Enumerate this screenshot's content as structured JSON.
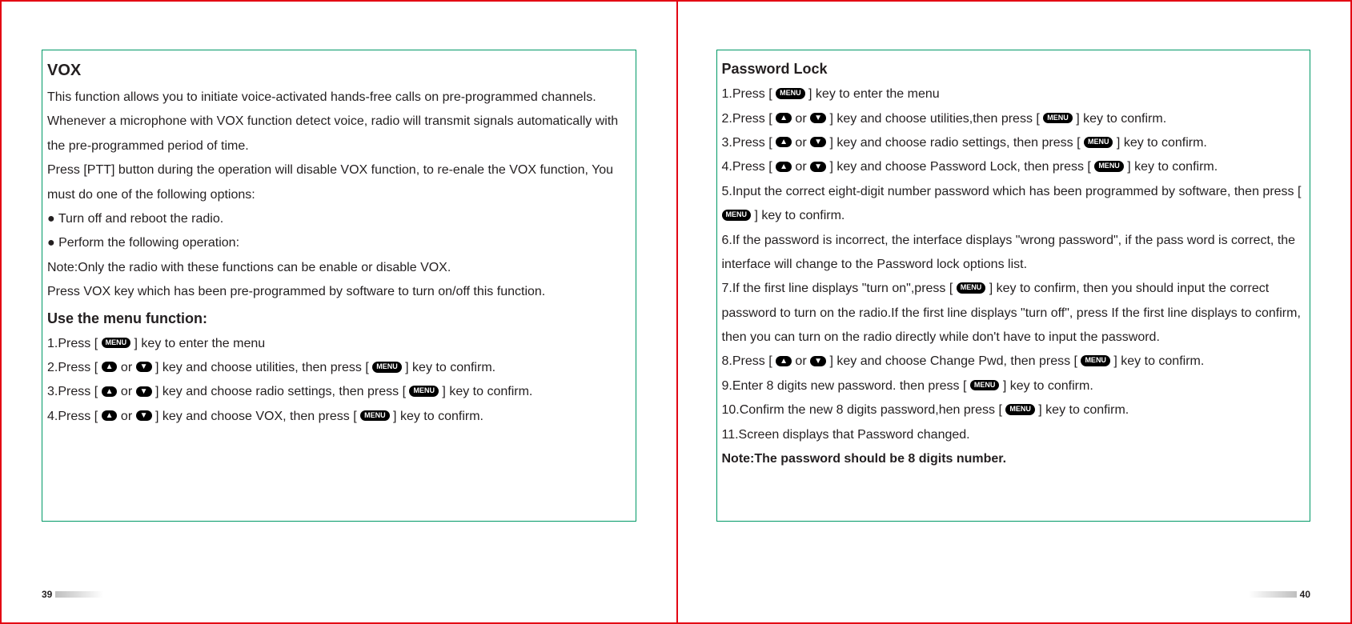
{
  "left": {
    "h1": "VOX",
    "p1": "This function allows you to initiate voice-activated hands-free calls on pre-programmed channels. Whenever a microphone with VOX function detect voice, radio will transmit signals automatically with the pre-programmed period of time.",
    "p2": "Press [PTT] button during the operation will disable VOX function, to re-enale the VOX function, You must do one of the following options:",
    "b1": "● Turn off and reboot the radio.",
    "b2": "● Perform the following operation:",
    "note": "Note:Only the radio with these functions can be enable or disable VOX.",
    "p3": "Press VOX key which has been pre-programmed by software to turn on/off this function.",
    "h2": "Use the menu function:",
    "s1a": "1.Press [ ",
    "s1b": " ] key to enter the menu",
    "s2a": "2.Press [ ",
    "s2b": " or ",
    "s2c": "  ] key and choose utilities, then press [ ",
    "s2d": " ] key to confirm.",
    "s3a": "3.Press [ ",
    "s3b": " or ",
    "s3c": "  ] key and choose radio settings, then press [ ",
    "s3d": " ] key to confirm.",
    "s4a": "4.Press [ ",
    "s4b": " or ",
    "s4c": "  ] key and choose VOX, then press [ ",
    "s4d": " ] key to confirm.",
    "page": "39"
  },
  "right": {
    "h1": "Password Lock",
    "s1a": "1.Press [ ",
    "s1b": " ] key to enter the menu",
    "s2a": "2.Press [ ",
    "s2b": " or ",
    "s2c": "  ] key and choose utilities,then press [ ",
    "s2d": " ] key to confirm.",
    "s3a": "3.Press [ ",
    "s3b": " or ",
    "s3c": "  ] key and choose radio settings, then press [ ",
    "s3d": " ] key to confirm.",
    "s4a": "4.Press [ ",
    "s4b": " or ",
    "s4c": "  ] key and choose Password Lock, then press [ ",
    "s4d": " ] key to confirm.",
    "s5a": "5.Input the correct eight-digit number password which has been programmed by software, then press [ ",
    "s5b": " ] key to confirm.",
    "s6": "6.If the password is incorrect, the interface displays \"wrong password\", if the pass word is correct, the interface will change to the Password lock options list.",
    "s7a": "7.If the first line displays \"turn on\",press [ ",
    "s7b": " ] key to confirm, then you should input the correct password to turn on the radio.If the first line displays \"turn off\", press If the first line displays to confirm, then you can turn on the radio directly while don't have to input the password.",
    "s8a": "8.Press [ ",
    "s8b": " or ",
    "s8c": "  ] key and choose Change Pwd, then press [ ",
    "s8d": " ] key to confirm.",
    "s9a": "9.Enter 8 digits new password. then press [ ",
    "s9b": " ] key to confirm.",
    "s10a": "10.Confirm the new 8 digits password,hen press [ ",
    "s10b": " ] key to confirm.",
    "s11": "11.Screen displays that Password changed.",
    "note": "Note:The password should be 8 digits number.",
    "page": "40"
  },
  "keys": {
    "menu": "MENU",
    "up": "▲",
    "down": "▼"
  }
}
